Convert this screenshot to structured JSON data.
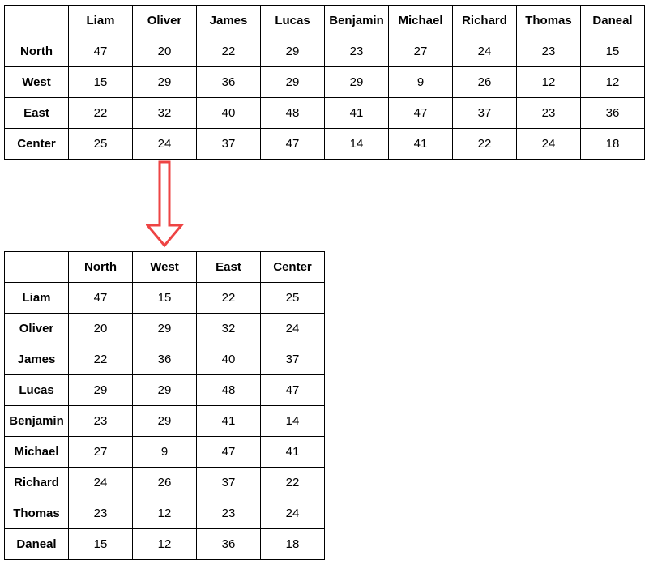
{
  "original_table": {
    "columns": [
      "Liam",
      "Oliver",
      "James",
      "Lucas",
      "Benjamin",
      "Michael",
      "Richard",
      "Thomas",
      "Daneal"
    ],
    "rows": [
      {
        "label": "North",
        "values": [
          "47",
          "20",
          "22",
          "29",
          "23",
          "27",
          "24",
          "23",
          "15"
        ]
      },
      {
        "label": "West",
        "values": [
          "15",
          "29",
          "36",
          "29",
          "29",
          "9",
          "26",
          "12",
          "12"
        ]
      },
      {
        "label": "East",
        "values": [
          "22",
          "32",
          "40",
          "48",
          "41",
          "47",
          "37",
          "23",
          "36"
        ]
      },
      {
        "label": "Center",
        "values": [
          "25",
          "24",
          "37",
          "47",
          "14",
          "41",
          "22",
          "24",
          "18"
        ]
      }
    ]
  },
  "arrow": {
    "icon": "down-arrow-icon",
    "color": "#ee4444"
  },
  "transposed_table": {
    "columns": [
      "North",
      "West",
      "East",
      "Center"
    ],
    "rows": [
      {
        "label": "Liam",
        "values": [
          "47",
          "15",
          "22",
          "25"
        ]
      },
      {
        "label": "Oliver",
        "values": [
          "20",
          "29",
          "32",
          "24"
        ]
      },
      {
        "label": "James",
        "values": [
          "22",
          "36",
          "40",
          "37"
        ]
      },
      {
        "label": "Lucas",
        "values": [
          "29",
          "29",
          "48",
          "47"
        ]
      },
      {
        "label": "Benjamin",
        "values": [
          "23",
          "29",
          "41",
          "14"
        ]
      },
      {
        "label": "Michael",
        "values": [
          "27",
          "9",
          "47",
          "41"
        ]
      },
      {
        "label": "Richard",
        "values": [
          "24",
          "26",
          "37",
          "22"
        ]
      },
      {
        "label": "Thomas",
        "values": [
          "23",
          "12",
          "23",
          "24"
        ]
      },
      {
        "label": "Daneal",
        "values": [
          "15",
          "12",
          "36",
          "18"
        ]
      }
    ]
  }
}
